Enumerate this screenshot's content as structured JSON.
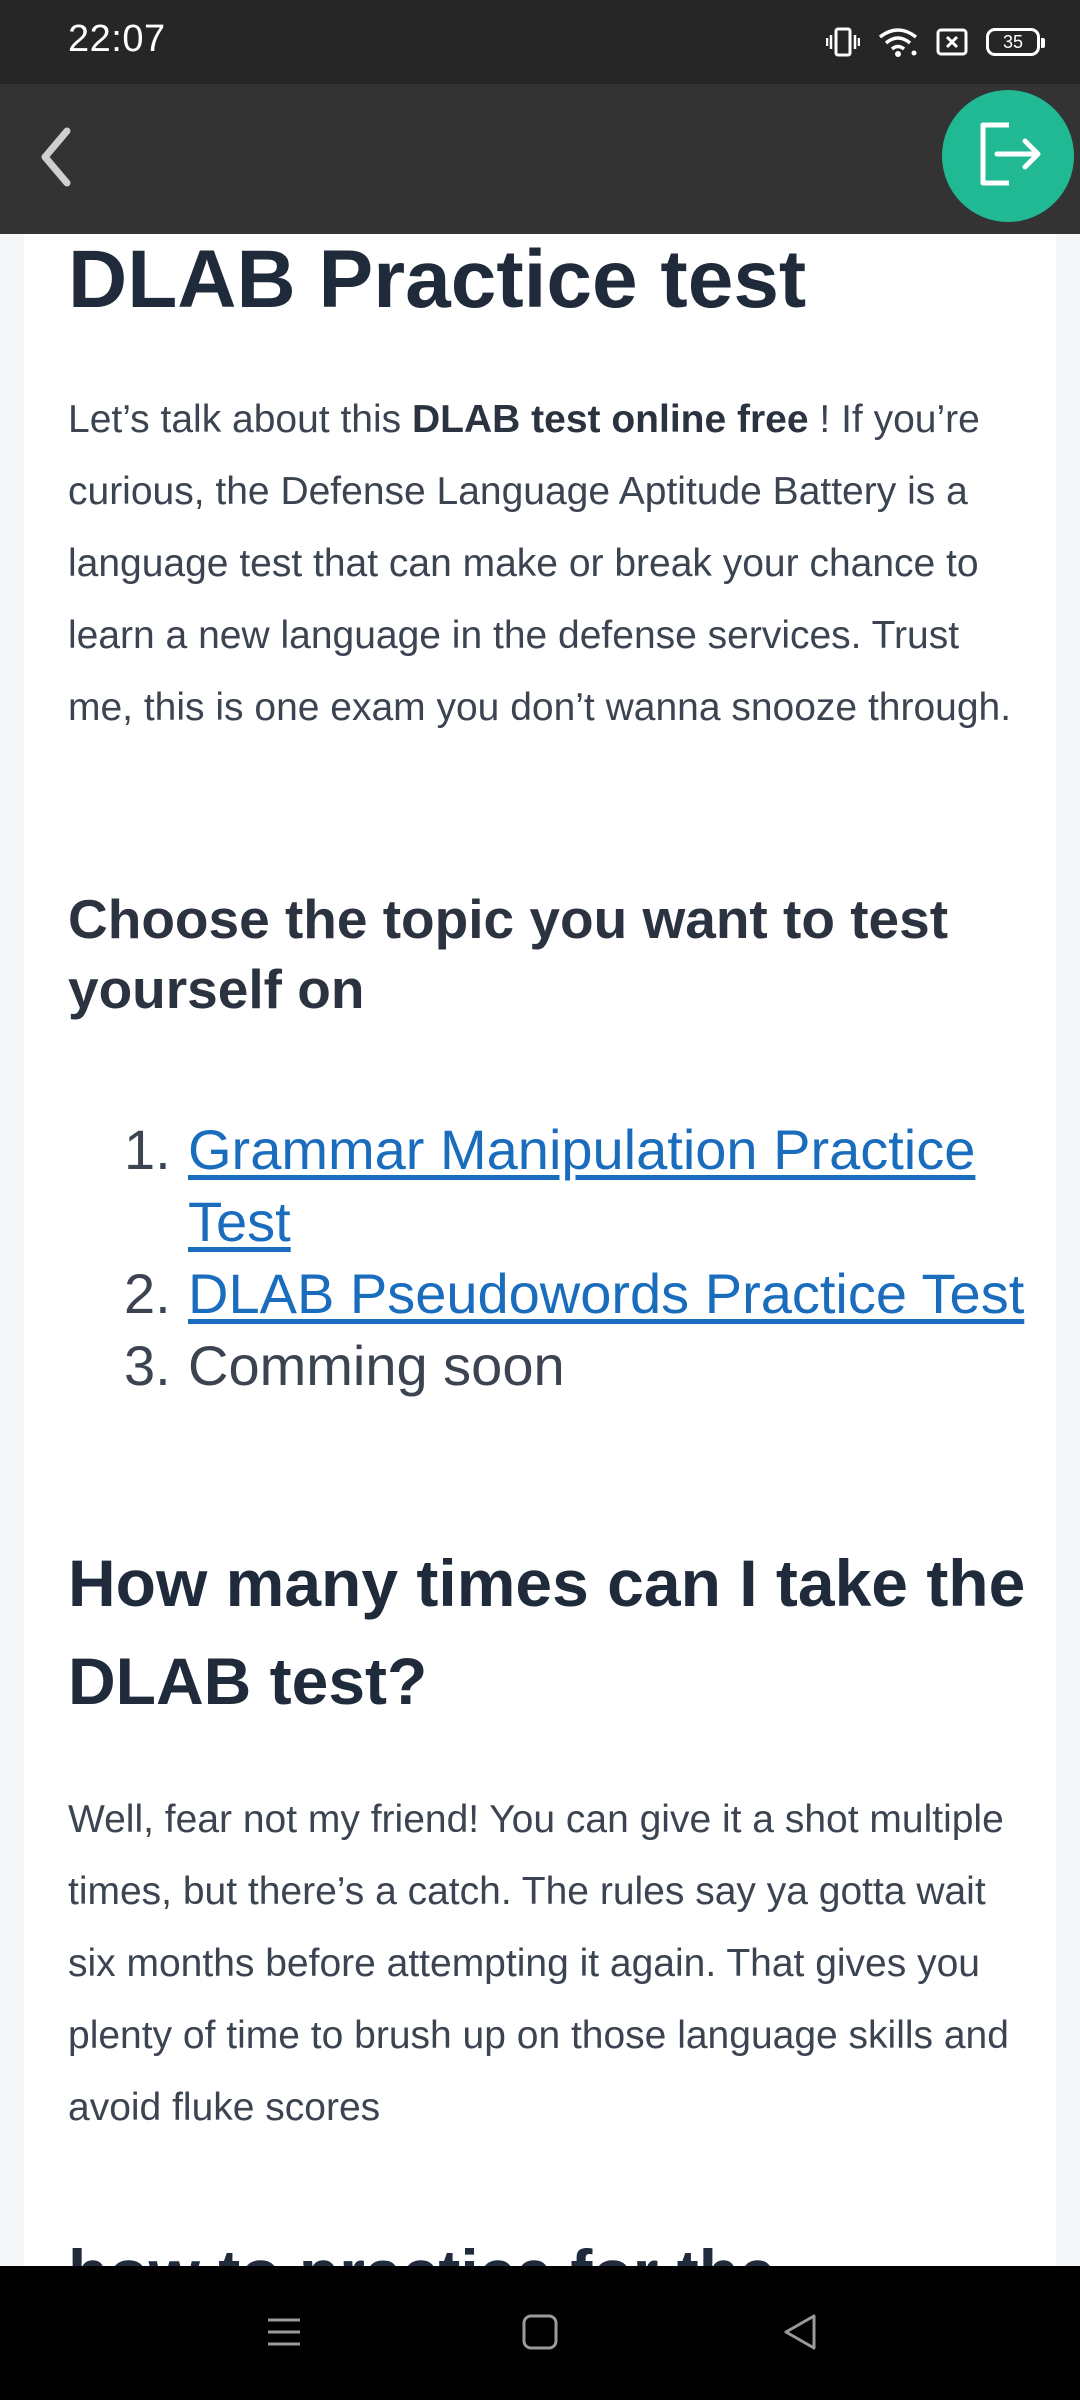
{
  "status_bar": {
    "time": "22:07",
    "battery": "35",
    "icons": [
      "vibrate-icon",
      "wifi-icon",
      "sim-off-icon",
      "battery-icon"
    ]
  },
  "header": {
    "back_icon": "chevron-left-icon",
    "exit_icon": "exit-icon",
    "exit_color": "#20b993"
  },
  "article": {
    "title": "DLAB Practice test",
    "intro": {
      "before": "Let’s talk about this ",
      "bold": "DLAB test online free",
      "after": " ! If you’re curious, the Defense Language Aptitude Battery is a language test that can make or break your chance to learn a new language in the defense services. Trust me, this is one exam you don’t wanna snooze through."
    },
    "topic_heading": "Choose the topic you want to test yourself on",
    "topics": [
      {
        "num": "1.",
        "label": "Grammar Manipulation Practice Test",
        "link": true
      },
      {
        "num": "2.",
        "label": "DLAB Pseudowords Practice Test",
        "link": true
      },
      {
        "num": "3.",
        "label": "Comming soon",
        "link": false
      }
    ],
    "faq_heading": "How many times can I take the DLAB test?",
    "faq_answer": "Well, fear not my friend! You can give it a shot multiple times, but there’s a catch. The rules say ya gotta wait six months before attempting it again. That gives you plenty of time to brush up on those language skills and avoid fluke scores",
    "next_heading": "how to practice for the"
  },
  "nav_bar": {
    "icons": [
      "menu-icon",
      "home-square-icon",
      "back-triangle-icon"
    ]
  }
}
